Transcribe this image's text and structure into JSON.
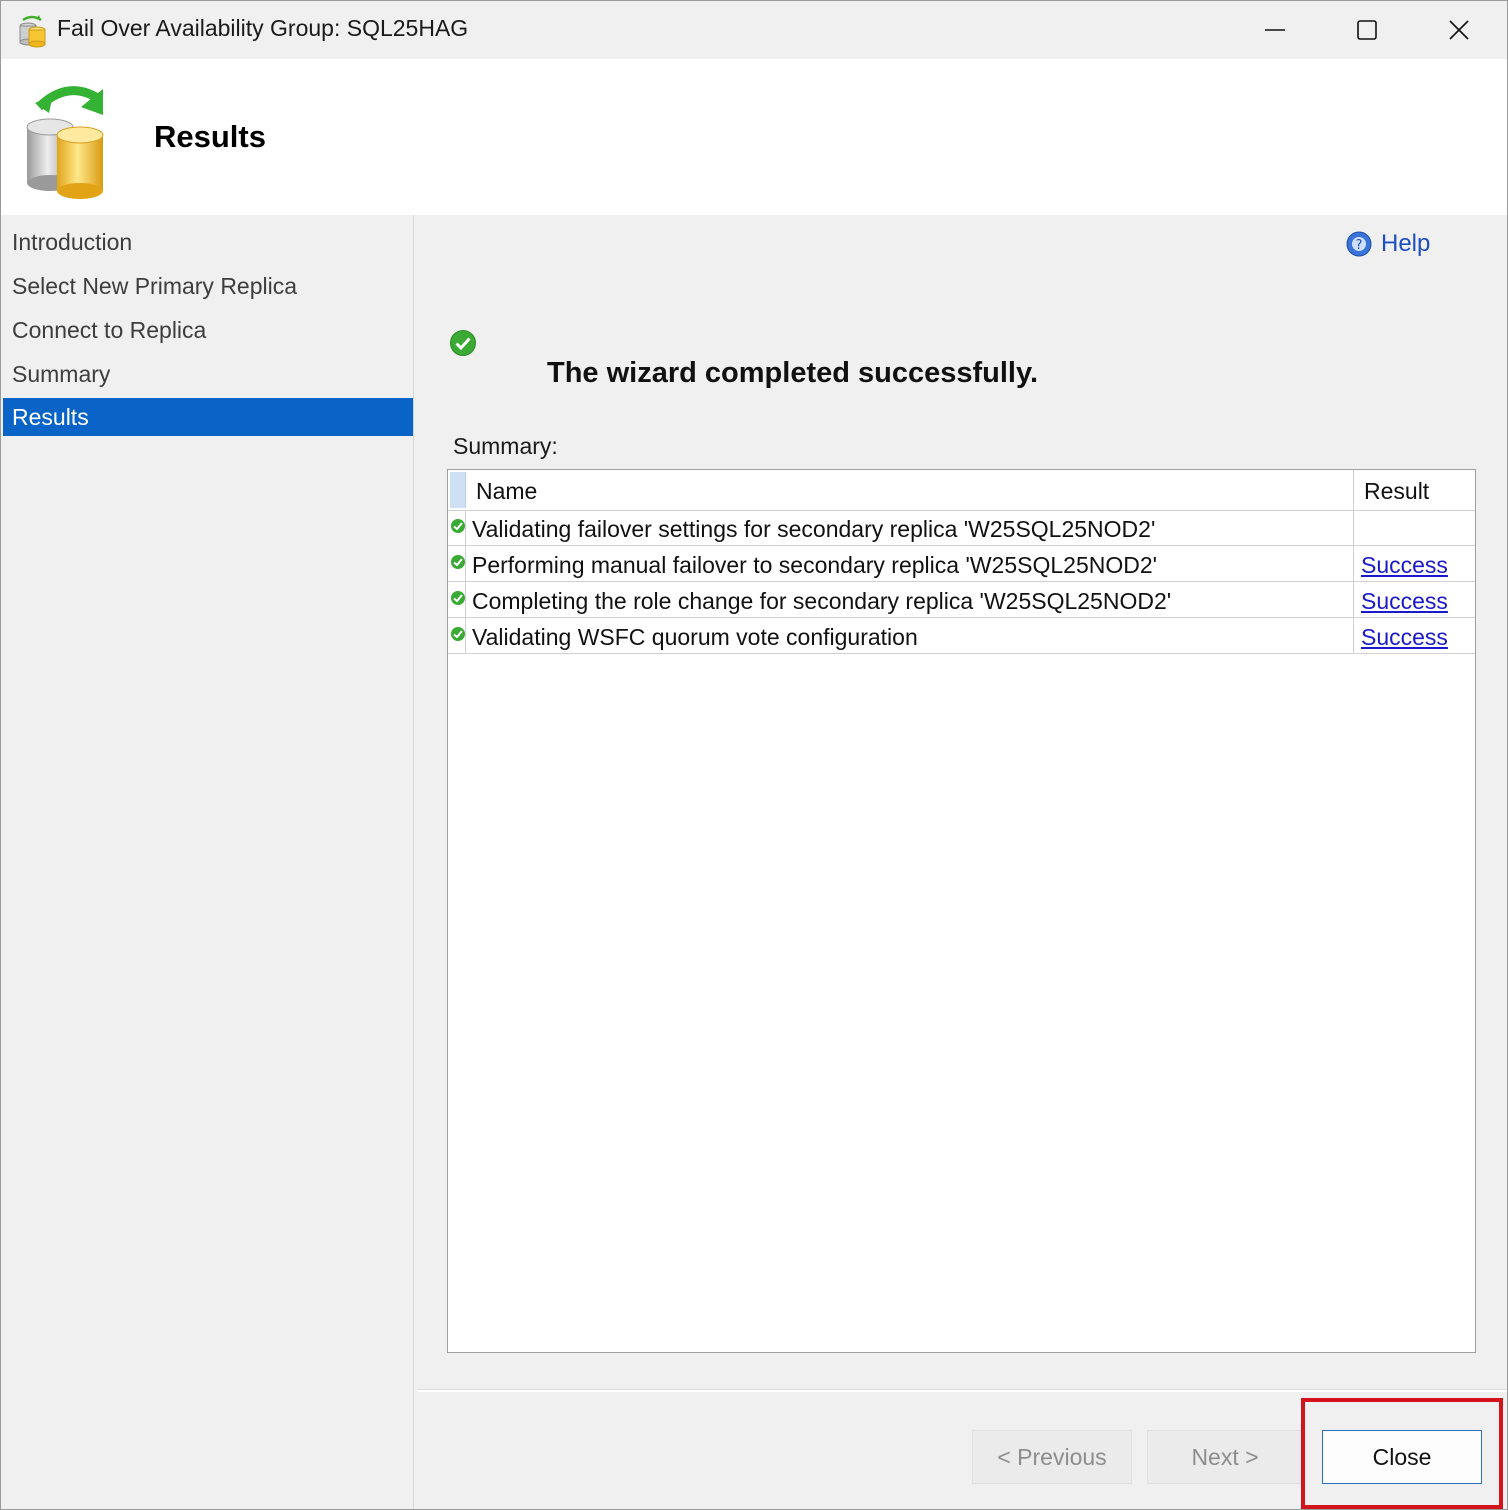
{
  "window": {
    "title": "Fail Over Availability Group: SQL25HAG",
    "controls": [
      "minimize",
      "maximize",
      "close"
    ]
  },
  "header": {
    "title": "Results",
    "icon": "database-failover-icon"
  },
  "nav": {
    "items": [
      {
        "label": "Introduction",
        "active": false
      },
      {
        "label": "Select New Primary Replica",
        "active": false
      },
      {
        "label": "Connect to Replica",
        "active": false
      },
      {
        "label": "Summary",
        "active": false
      },
      {
        "label": "Results",
        "active": true
      }
    ]
  },
  "main": {
    "help_label": "Help",
    "status_message": "The wizard completed successfully.",
    "summary_label": "Summary:",
    "table": {
      "columns": [
        "Name",
        "Result"
      ],
      "rows": [
        {
          "name": "Validating failover settings for secondary replica 'W25SQL25NOD2'",
          "result": "",
          "status_icon": "success-check-icon"
        },
        {
          "name": "Performing manual failover to secondary replica 'W25SQL25NOD2'",
          "result": "Success",
          "status_icon": "success-check-icon"
        },
        {
          "name": "Completing the role change for secondary replica 'W25SQL25NOD2'",
          "result": "Success",
          "status_icon": "success-check-icon"
        },
        {
          "name": "Validating WSFC quorum vote configuration",
          "result": "Success",
          "status_icon": "success-check-icon"
        }
      ]
    }
  },
  "buttons": {
    "previous": "< Previous",
    "next": "Next >",
    "close": "Close"
  },
  "colors": {
    "accent": "#0a64c8",
    "link": "#1a1acc",
    "highlight": "#d4141c",
    "success": "#3aaa35"
  }
}
